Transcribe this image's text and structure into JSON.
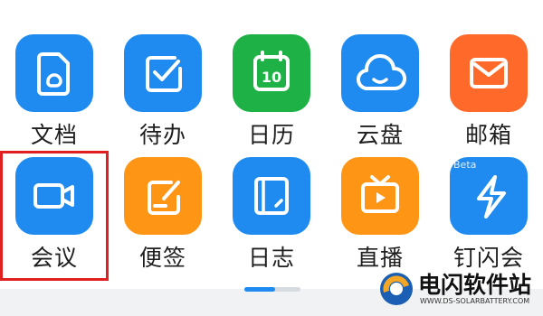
{
  "apps": [
    {
      "label": "文档",
      "icon": "document-icon",
      "color": "#1f8bf0"
    },
    {
      "label": "待办",
      "icon": "todo-check-icon",
      "color": "#1f8bf0"
    },
    {
      "label": "日历",
      "icon": "calendar-icon",
      "color": "#1eb145",
      "icon_text": "10"
    },
    {
      "label": "云盘",
      "icon": "cloud-drive-icon",
      "color": "#1f8bf0"
    },
    {
      "label": "邮箱",
      "icon": "mail-icon",
      "color": "#ff6a2a"
    },
    {
      "label": "会议",
      "icon": "video-camera-icon",
      "color": "#1f8bf0",
      "highlighted": true
    },
    {
      "label": "便签",
      "icon": "note-pen-icon",
      "color": "#ff9514"
    },
    {
      "label": "日志",
      "icon": "journal-icon",
      "color": "#1f8bf0"
    },
    {
      "label": "直播",
      "icon": "tv-play-icon",
      "color": "#ff9514"
    },
    {
      "label": "钉闪会",
      "icon": "lightning-icon",
      "color": "#1f8bf0",
      "badge": "Beta"
    }
  ],
  "pager": {
    "pages": 2,
    "active": 1
  },
  "watermark": {
    "title": "电闪软件站",
    "subtitle": "WWW.DS-SOLARBATTERY.COM"
  }
}
